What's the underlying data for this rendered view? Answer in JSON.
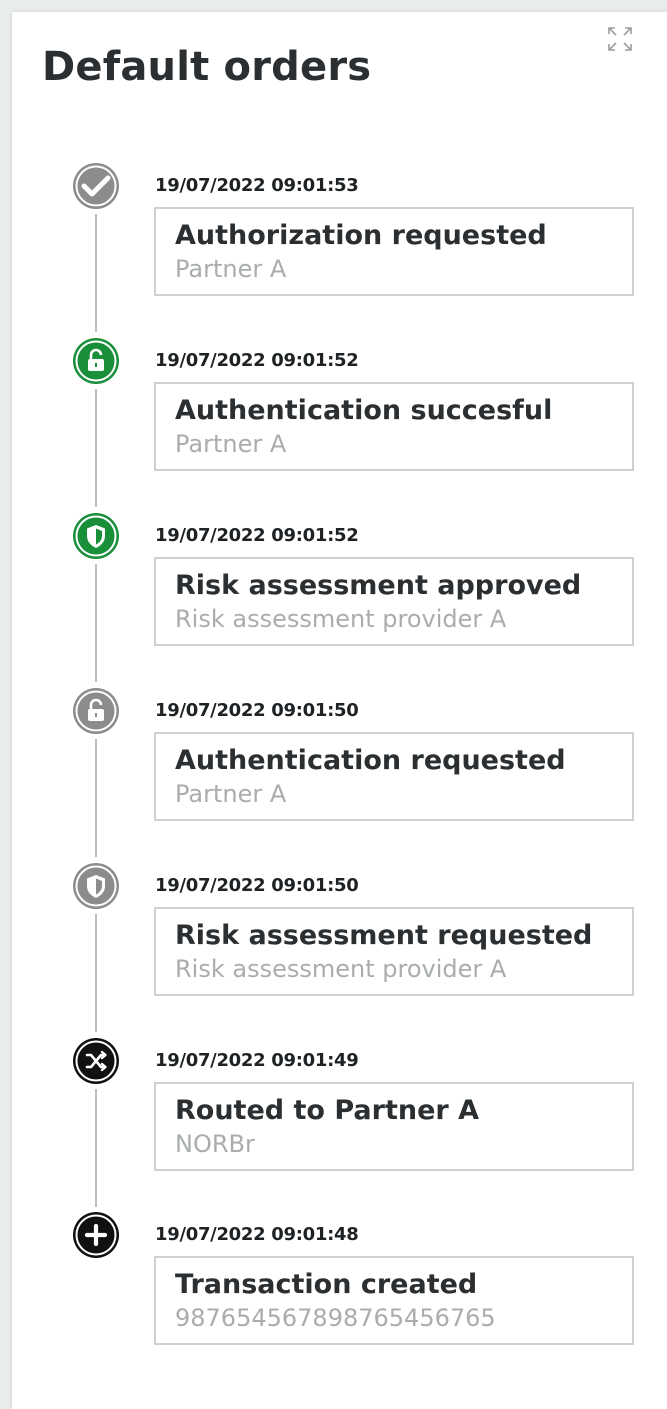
{
  "panel": {
    "title": "Default orders",
    "expand_icon": "expand-icon"
  },
  "colors": {
    "grey": "#8c8c8c",
    "green": "#1a8f3a",
    "black": "#111111",
    "connector": "#bdbdbd"
  },
  "events": [
    {
      "timestamp": "19/07/2022 09:01:53",
      "title": "Authorization requested",
      "subtitle": "Partner A",
      "icon": "check-icon",
      "status": "grey"
    },
    {
      "timestamp": "19/07/2022 09:01:52",
      "title": "Authentication succesful",
      "subtitle": "Partner A",
      "icon": "lock-icon",
      "status": "green"
    },
    {
      "timestamp": "19/07/2022 09:01:52",
      "title": "Risk assessment approved",
      "subtitle": "Risk assessment provider A",
      "icon": "shield-icon",
      "status": "green"
    },
    {
      "timestamp": "19/07/2022 09:01:50",
      "title": "Authentication requested",
      "subtitle": "Partner A",
      "icon": "lock-icon",
      "status": "grey"
    },
    {
      "timestamp": "19/07/2022 09:01:50",
      "title": "Risk assessment requested",
      "subtitle": "Risk assessment provider A",
      "icon": "shield-icon",
      "status": "grey"
    },
    {
      "timestamp": "19/07/2022 09:01:49",
      "title": "Routed to Partner A",
      "subtitle": "NORBr",
      "icon": "route-icon",
      "status": "black"
    },
    {
      "timestamp": "19/07/2022 09:01:48",
      "title": "Transaction created",
      "subtitle": "98765456789876545676​5",
      "icon": "plus-icon",
      "status": "black"
    }
  ]
}
